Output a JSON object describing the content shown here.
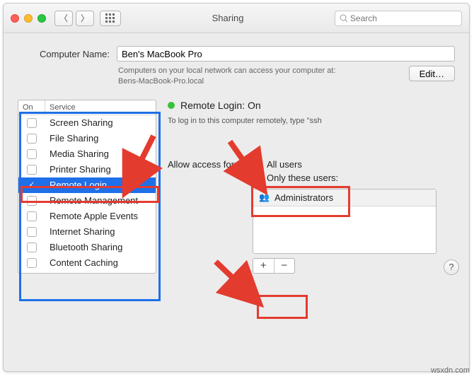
{
  "window": {
    "title": "Sharing"
  },
  "toolbar": {
    "search_placeholder": "Search"
  },
  "computer_name": {
    "label": "Computer Name:",
    "value": "Ben's MacBook Pro",
    "hint_line1": "Computers on your local network can access your computer at:",
    "hint_line2": "Bens-MacBook-Pro.local",
    "edit_label": "Edit…"
  },
  "services": {
    "col_on": "On",
    "col_service": "Service",
    "items": [
      {
        "label": "Screen Sharing",
        "on": false
      },
      {
        "label": "File Sharing",
        "on": false
      },
      {
        "label": "Media Sharing",
        "on": false
      },
      {
        "label": "Printer Sharing",
        "on": false
      },
      {
        "label": "Remote Login",
        "on": true,
        "selected": true
      },
      {
        "label": "Remote Management",
        "on": false
      },
      {
        "label": "Remote Apple Events",
        "on": false
      },
      {
        "label": "Internet Sharing",
        "on": false
      },
      {
        "label": "Bluetooth Sharing",
        "on": false
      },
      {
        "label": "Content Caching",
        "on": false
      }
    ]
  },
  "detail": {
    "status_label": "Remote Login: On",
    "status_color": "#36c23a",
    "instruction": "To log in to this computer remotely, type \"ssh",
    "allow_label": "Allow access for:",
    "radio_all": "All users",
    "radio_only": "Only these users:",
    "radio_selected": "only",
    "users": [
      {
        "label": "Administrators",
        "icon": "group-icon"
      }
    ]
  },
  "buttons": {
    "add": "+",
    "remove": "−",
    "help": "?"
  },
  "watermark": "wsxdn.com"
}
